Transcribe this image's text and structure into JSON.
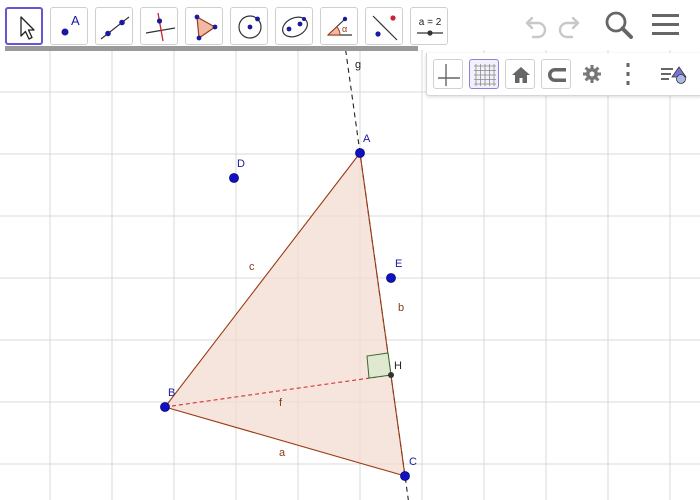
{
  "toolbar": {
    "tools": [
      {
        "id": "move",
        "icon": "cursor-arrow-icon",
        "selected": true
      },
      {
        "id": "point",
        "icon": "point-tool-icon",
        "label": "A"
      },
      {
        "id": "line",
        "icon": "line-tool-icon"
      },
      {
        "id": "perpendicular",
        "icon": "perpendicular-line-icon"
      },
      {
        "id": "polygon",
        "icon": "polygon-tool-icon"
      },
      {
        "id": "circle",
        "icon": "circle-tool-icon"
      },
      {
        "id": "conic",
        "icon": "conic-tool-icon"
      },
      {
        "id": "angle",
        "icon": "angle-tool-icon",
        "label": "α"
      },
      {
        "id": "reflect",
        "icon": "reflect-tool-icon"
      },
      {
        "id": "slider",
        "icon": "slider-tool-icon",
        "label": "a = 2"
      }
    ],
    "progress_fraction": 1.0
  },
  "header": {
    "undo_icon": "undo-icon",
    "redo_icon": "redo-icon",
    "search_icon": "search-icon",
    "menu_icon": "hamburger-menu-icon"
  },
  "stylebar": {
    "buttons": [
      {
        "id": "axes",
        "icon": "axes-toggle-icon",
        "active": false
      },
      {
        "id": "grid",
        "icon": "grid-toggle-icon",
        "active": true
      },
      {
        "id": "home",
        "icon": "home-icon",
        "active": false
      },
      {
        "id": "snap",
        "icon": "magnet-icon",
        "active": false
      },
      {
        "id": "settings",
        "icon": "gear-icon",
        "active": false
      },
      {
        "id": "more",
        "icon": "more-vertical-icon",
        "active": false
      },
      {
        "id": "toggle-style",
        "icon": "style-toggle-icon",
        "active": false
      }
    ]
  },
  "geometry": {
    "points": [
      {
        "name": "A",
        "label": "A"
      },
      {
        "name": "B",
        "label": "B"
      },
      {
        "name": "C",
        "label": "C"
      },
      {
        "name": "D",
        "label": "D"
      },
      {
        "name": "E",
        "label": "E"
      },
      {
        "name": "H",
        "label": "H"
      }
    ],
    "segments": [
      {
        "name": "a",
        "label": "a",
        "from": "B",
        "to": "C"
      },
      {
        "name": "b",
        "label": "b",
        "from": "A",
        "to": "C"
      },
      {
        "name": "c",
        "label": "c",
        "from": "A",
        "to": "B"
      },
      {
        "name": "f",
        "label": "f",
        "from": "B",
        "to": "H",
        "dashed": true
      }
    ],
    "lines": [
      {
        "name": "g",
        "label": "g",
        "through": [
          "A",
          "C"
        ],
        "dashed": true
      }
    ],
    "colors": {
      "point": "#1010c8",
      "polygon_fill": "#f3dcd2",
      "polygon_edge": "#9c3a14",
      "altitude": "#d43030",
      "right_angle_fill": "#dfe8d0",
      "right_angle_edge": "#3a6a2a",
      "grid": "#d9d9d9",
      "accent": "#6557d2"
    }
  }
}
